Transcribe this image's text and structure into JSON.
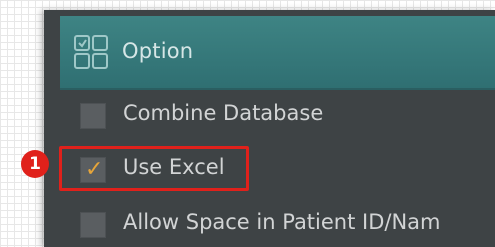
{
  "panel": {
    "title": "Option",
    "icon": "grid-layout-icon"
  },
  "options": [
    {
      "label": "Combine Database",
      "checked": false
    },
    {
      "label": "Use Excel",
      "checked": true
    },
    {
      "label": "Allow Space in Patient ID/Nam",
      "checked": false
    }
  ],
  "annotation": {
    "step_number": "1",
    "highlight_color": "#e0211b"
  },
  "colors": {
    "header": "#2f6f72",
    "panel": "#3e4345",
    "check": "#e6a53a"
  }
}
